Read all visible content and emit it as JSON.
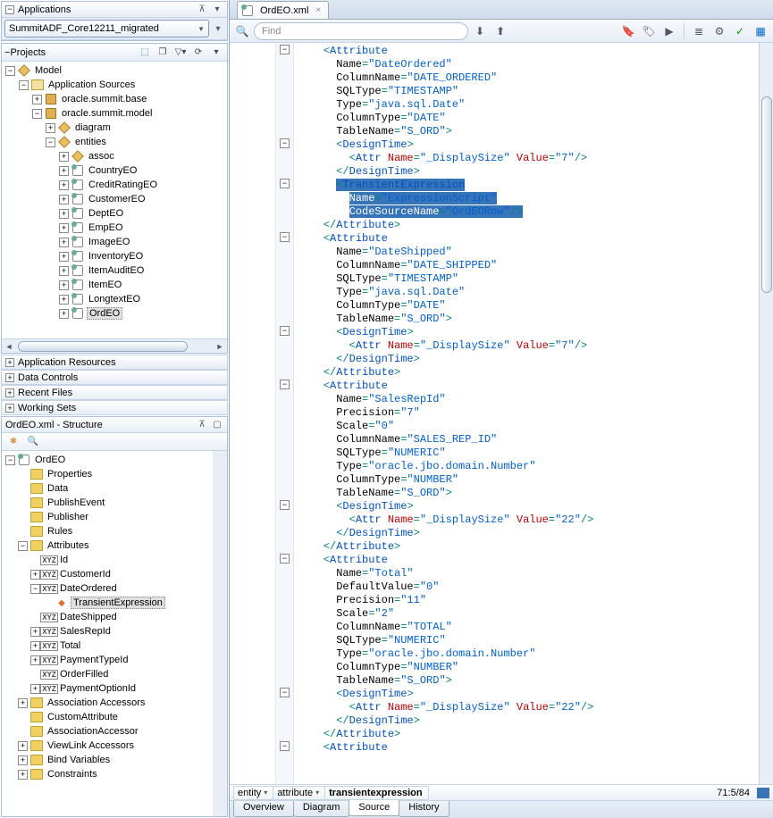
{
  "applications": {
    "title": "Applications",
    "dropdown_value": "SummitADF_Core12211_migrated"
  },
  "projects": {
    "title": "Projects",
    "tree": {
      "root": "Model",
      "app_sources": "Application Sources",
      "pkg_base": "oracle.summit.base",
      "pkg_model": "oracle.summit.model",
      "diagram": "diagram",
      "entities": "entities",
      "entity_items": [
        "assoc",
        "CountryEO",
        "CreditRatingEO",
        "CustomerEO",
        "DeptEO",
        "EmpEO",
        "ImageEO",
        "InventoryEO",
        "ItemAuditEO",
        "ItemEO",
        "LongtextEO",
        "OrdEO"
      ]
    }
  },
  "collapsed_panels": [
    "Application Resources",
    "Data Controls",
    "Recent Files",
    "Working Sets"
  ],
  "structure": {
    "title": "OrdEO.xml - Structure",
    "root": "OrdEO",
    "folders_top": [
      "Properties",
      "Data",
      "PublishEvent",
      "Publisher",
      "Rules"
    ],
    "attributes_label": "Attributes",
    "attrs": [
      "Id",
      "CustomerId",
      "DateOrdered",
      "DateShipped",
      "SalesRepId",
      "Total",
      "PaymentTypeId",
      "OrderFilled",
      "PaymentOptionId"
    ],
    "transient_label": "TransientExpression",
    "folders_bottom": [
      "Association Accessors",
      "CustomAttribute",
      "AssociationAccessor",
      "ViewLink Accessors",
      "Bind Variables",
      "Constraints"
    ]
  },
  "editor": {
    "tab_title": "OrdEO.xml",
    "find_placeholder": "Find",
    "breadcrumb": [
      "entity",
      "attribute",
      "transientexpression"
    ],
    "status": "71:5/84",
    "bottom_tabs": [
      "Overview",
      "Diagram",
      "Source",
      "History"
    ],
    "active_bottom_tab": "Source"
  },
  "code_lines": [
    {
      "i": 0,
      "t": "    <Attribute",
      "fold": "minus"
    },
    {
      "i": 0,
      "t": "      Name=\"DateOrdered\""
    },
    {
      "i": 0,
      "t": "      ColumnName=\"DATE_ORDERED\""
    },
    {
      "i": 0,
      "t": "      SQLType=\"TIMESTAMP\""
    },
    {
      "i": 0,
      "t": "      Type=\"java.sql.Date\""
    },
    {
      "i": 0,
      "t": "      ColumnType=\"DATE\""
    },
    {
      "i": 0,
      "t": "      TableName=\"S_ORD\">"
    },
    {
      "i": 0,
      "t": "      <DesignTime>",
      "fold": "minus"
    },
    {
      "i": 0,
      "t": "        <Attr Name=\"_DisplaySize\" Value=\"7\"/>"
    },
    {
      "i": 0,
      "t": "      </DesignTime>"
    },
    {
      "i": 0,
      "t": "      <TransientExpression",
      "hl": true,
      "fold": "minus"
    },
    {
      "i": 0,
      "t": "        Name=\"ExpressionScript\"",
      "hl": true
    },
    {
      "i": 0,
      "t": "        CodeSourceName=\"OrdEORow\"/>",
      "hl": true
    },
    {
      "i": 0,
      "t": "    </Attribute>"
    },
    {
      "i": 0,
      "t": "    <Attribute",
      "fold": "minus"
    },
    {
      "i": 0,
      "t": "      Name=\"DateShipped\""
    },
    {
      "i": 0,
      "t": "      ColumnName=\"DATE_SHIPPED\""
    },
    {
      "i": 0,
      "t": "      SQLType=\"TIMESTAMP\""
    },
    {
      "i": 0,
      "t": "      Type=\"java.sql.Date\""
    },
    {
      "i": 0,
      "t": "      ColumnType=\"DATE\""
    },
    {
      "i": 0,
      "t": "      TableName=\"S_ORD\">"
    },
    {
      "i": 0,
      "t": "      <DesignTime>",
      "fold": "minus"
    },
    {
      "i": 0,
      "t": "        <Attr Name=\"_DisplaySize\" Value=\"7\"/>"
    },
    {
      "i": 0,
      "t": "      </DesignTime>"
    },
    {
      "i": 0,
      "t": "    </Attribute>"
    },
    {
      "i": 0,
      "t": "    <Attribute",
      "fold": "minus"
    },
    {
      "i": 0,
      "t": "      Name=\"SalesRepId\""
    },
    {
      "i": 0,
      "t": "      Precision=\"7\""
    },
    {
      "i": 0,
      "t": "      Scale=\"0\""
    },
    {
      "i": 0,
      "t": "      ColumnName=\"SALES_REP_ID\""
    },
    {
      "i": 0,
      "t": "      SQLType=\"NUMERIC\""
    },
    {
      "i": 0,
      "t": "      Type=\"oracle.jbo.domain.Number\""
    },
    {
      "i": 0,
      "t": "      ColumnType=\"NUMBER\""
    },
    {
      "i": 0,
      "t": "      TableName=\"S_ORD\">"
    },
    {
      "i": 0,
      "t": "      <DesignTime>",
      "fold": "minus"
    },
    {
      "i": 0,
      "t": "        <Attr Name=\"_DisplaySize\" Value=\"22\"/>"
    },
    {
      "i": 0,
      "t": "      </DesignTime>"
    },
    {
      "i": 0,
      "t": "    </Attribute>"
    },
    {
      "i": 0,
      "t": "    <Attribute",
      "fold": "minus"
    },
    {
      "i": 0,
      "t": "      Name=\"Total\""
    },
    {
      "i": 0,
      "t": "      DefaultValue=\"0\""
    },
    {
      "i": 0,
      "t": "      Precision=\"11\""
    },
    {
      "i": 0,
      "t": "      Scale=\"2\""
    },
    {
      "i": 0,
      "t": "      ColumnName=\"TOTAL\""
    },
    {
      "i": 0,
      "t": "      SQLType=\"NUMERIC\""
    },
    {
      "i": 0,
      "t": "      Type=\"oracle.jbo.domain.Number\""
    },
    {
      "i": 0,
      "t": "      ColumnType=\"NUMBER\""
    },
    {
      "i": 0,
      "t": "      TableName=\"S_ORD\">"
    },
    {
      "i": 0,
      "t": "      <DesignTime>",
      "fold": "minus"
    },
    {
      "i": 0,
      "t": "        <Attr Name=\"_DisplaySize\" Value=\"22\"/>"
    },
    {
      "i": 0,
      "t": "      </DesignTime>"
    },
    {
      "i": 0,
      "t": "    </Attribute>"
    },
    {
      "i": 0,
      "t": "    <Attribute",
      "fold": "minus"
    }
  ]
}
